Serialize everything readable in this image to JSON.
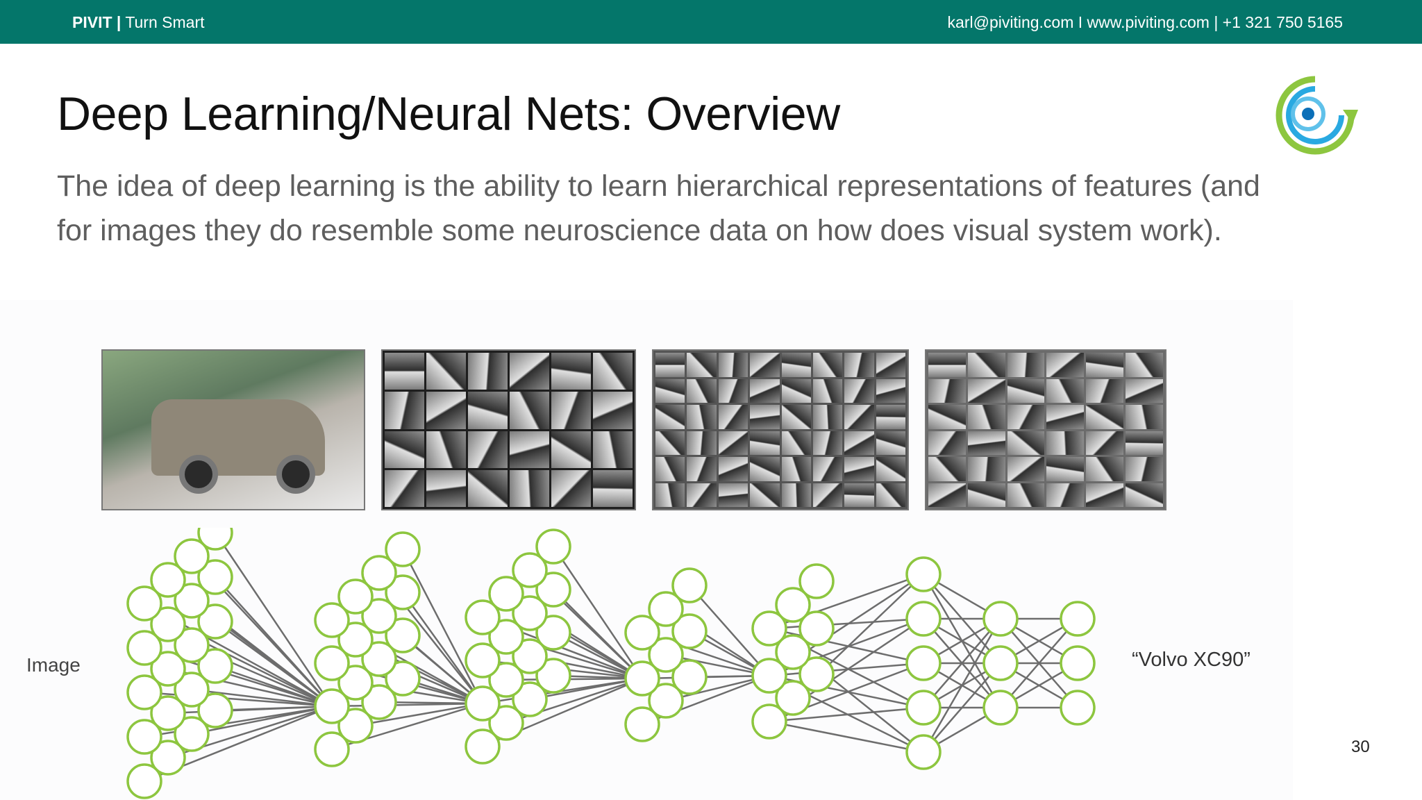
{
  "header": {
    "brand_name": "PIVIT |",
    "brand_tagline": " Turn Smart",
    "contact": "karl@piviting.com I www.piviting.com | +1 321 750 5165",
    "background_color": "#04766a"
  },
  "slide": {
    "title": "Deep Learning/Neural Nets: Overview",
    "body": "The idea of deep learning is the ability to learn hierarchical representations of features (and for images they do resemble some neuroscience data on how does visual system work).",
    "page_number": "30"
  },
  "figure": {
    "input_label": "Image",
    "output_label": "“Volvo XC90”",
    "node_color": "#8dc63f"
  },
  "logo": {
    "icon": "pivit-logo-icon",
    "colors": [
      "#8dc63f",
      "#29a9e1",
      "#0b6fb8"
    ]
  }
}
